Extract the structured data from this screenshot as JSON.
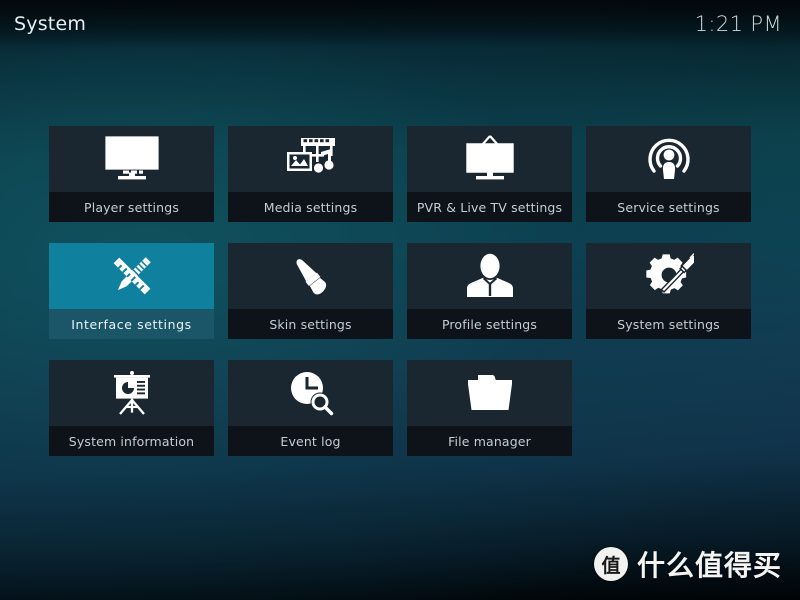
{
  "header": {
    "title": "System",
    "clock": "1:21 PM"
  },
  "colors": {
    "accent": "#10809f",
    "accent_label": "#1b5568",
    "tile_icon_bg": "#1a2630",
    "tile_label_bg": "#0d1319",
    "label_text": "#c3ced4",
    "background_top": "#020608",
    "background_mid": "#0d4354",
    "background_bottom": "#000305"
  },
  "grid": {
    "columns": 4,
    "tiles": [
      {
        "label": "Player settings",
        "icon": "monitor-play-icon",
        "selected": false
      },
      {
        "label": "Media settings",
        "icon": "film-photo-music-icon",
        "selected": false
      },
      {
        "label": "PVR & Live TV settings",
        "icon": "tv-antenna-icon",
        "selected": false
      },
      {
        "label": "Service settings",
        "icon": "podcast-broadcast-icon",
        "selected": false
      },
      {
        "label": "Interface settings",
        "icon": "pencil-ruler-icon",
        "selected": true
      },
      {
        "label": "Skin settings",
        "icon": "paintbrush-icon",
        "selected": false
      },
      {
        "label": "Profile settings",
        "icon": "person-icon",
        "selected": false
      },
      {
        "label": "System settings",
        "icon": "gear-screwdriver-icon",
        "selected": false
      },
      {
        "label": "System information",
        "icon": "presentation-chart-icon",
        "selected": false
      },
      {
        "label": "Event log",
        "icon": "clock-magnifier-icon",
        "selected": false
      },
      {
        "label": "File manager",
        "icon": "folder-icon",
        "selected": false
      }
    ]
  },
  "watermark": {
    "badge": "值",
    "text": "什么值得买"
  }
}
